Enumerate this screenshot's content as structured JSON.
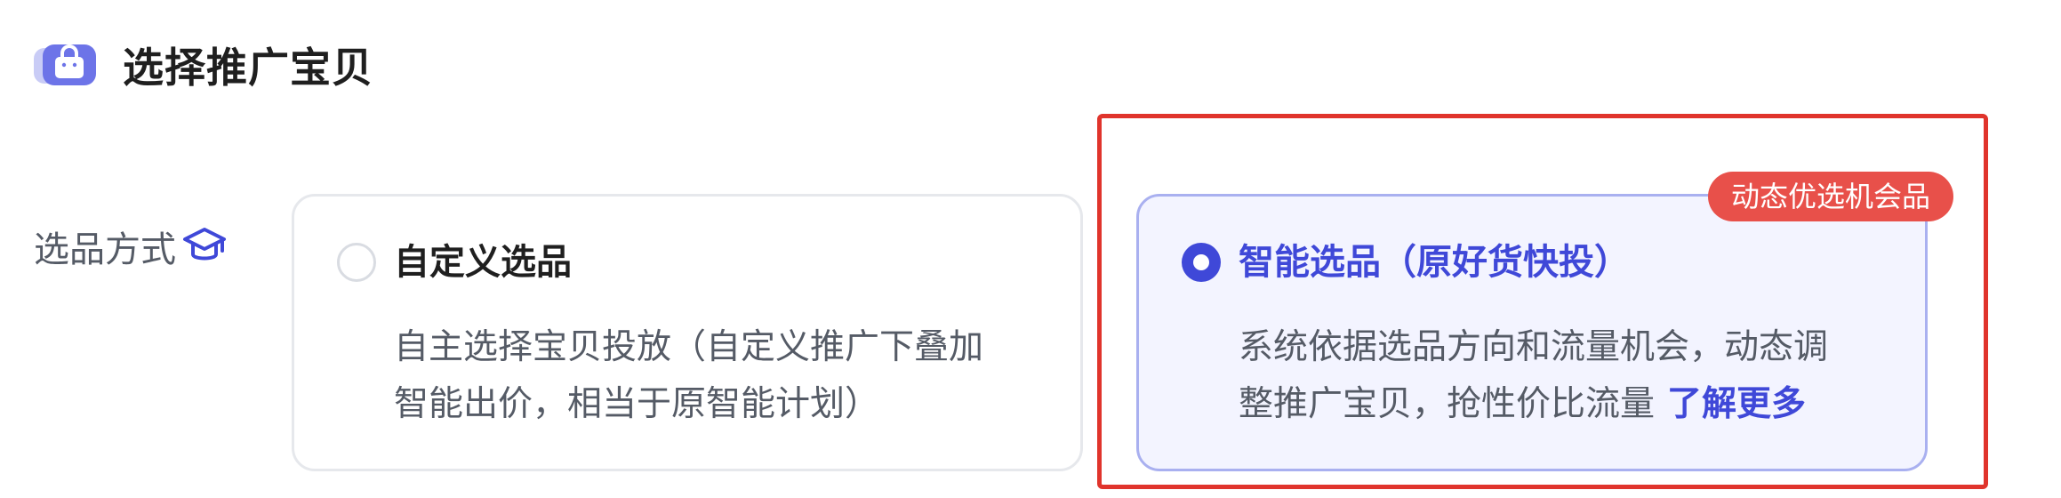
{
  "header": {
    "title": "选择推广宝贝",
    "icon": "shopping-bag-icon"
  },
  "field": {
    "label": "选品方式",
    "help_icon": "graduation-cap-icon"
  },
  "options": [
    {
      "title": "自定义选品",
      "selected": false,
      "description_lines": [
        "自主选择宝贝投放（自定义推广下叠加",
        "智能出价，相当于原智能计划）"
      ]
    },
    {
      "title": "智能选品（原好货快投）",
      "selected": true,
      "badge": "动态优选机会品",
      "description_lines": [
        "系统依据选品方向和流量机会，动态调",
        "整推广宝贝，抢性价比流量"
      ],
      "learn_more": "了解更多"
    }
  ],
  "colors": {
    "accent": "#3f48d8",
    "badge": "#e8504a",
    "highlight": "#e0342c",
    "selected_bg": "#f3f4ff"
  }
}
